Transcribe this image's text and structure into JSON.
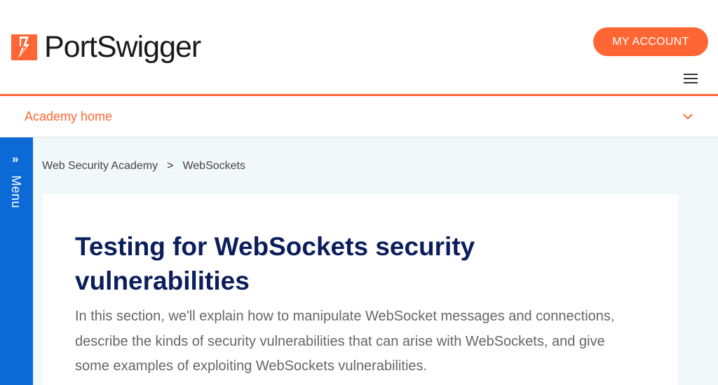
{
  "header": {
    "logo_text": "PortSwigger",
    "account_button": "MY ACCOUNT",
    "brand_color": "#ff6633",
    "logo_icon": "portswigger-bolt-icon",
    "menu_icon": "hamburger-icon"
  },
  "subnav": {
    "link": "Academy home",
    "chevron_icon": "chevron-down-icon"
  },
  "sidebar": {
    "arrows": "»",
    "label": "Menu",
    "color": "#0c6ad6"
  },
  "breadcrumb": {
    "items": [
      "Web Security Academy",
      "WebSockets"
    ],
    "separator": ">"
  },
  "article": {
    "title": "Testing for WebSockets security vulnerabilities",
    "intro": "In this section, we'll explain how to manipulate WebSocket messages and connections, describe the kinds of security vulnerabilities that can arise with WebSockets, and give some examples of exploiting WebSockets vulnerabilities."
  }
}
